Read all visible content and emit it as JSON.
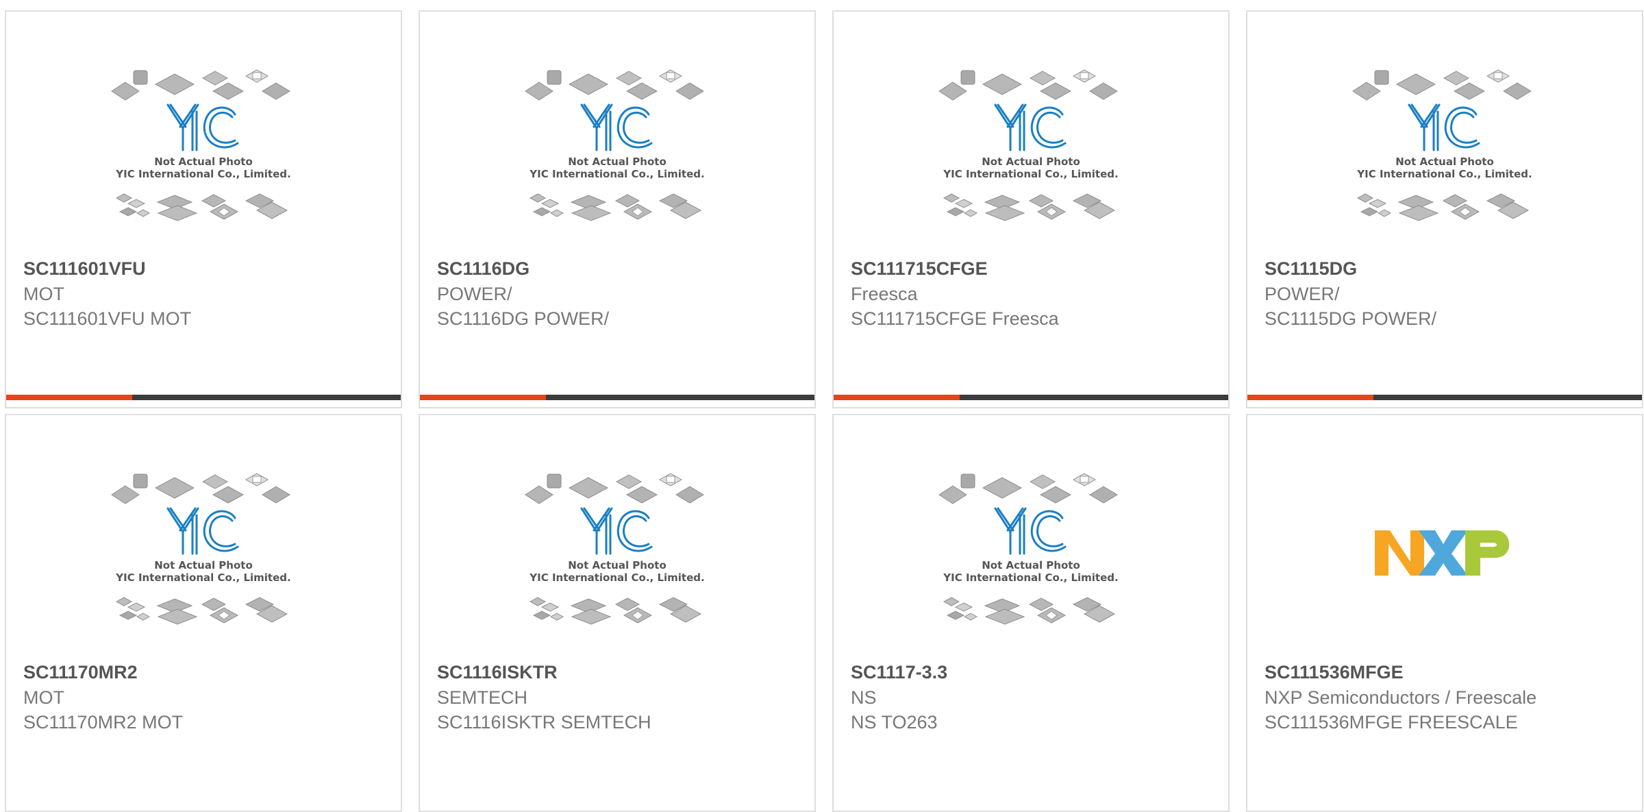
{
  "colors": {
    "accent": "#e8431a",
    "bar_dark": "#3b3b3b",
    "yic_blue": "#1a7fc4",
    "nxp_orange": "#f6a623",
    "nxp_blue": "#4fa8dc",
    "nxp_green": "#a9c93b"
  },
  "placeholder": {
    "line1": "Not Actual Photo",
    "line2": "YIC International Co., Limited."
  },
  "products": [
    {
      "part": "SC111601VFU",
      "manufacturer": "MOT",
      "description": "SC111601VFU MOT",
      "image": "yic-placeholder",
      "show_bar": true
    },
    {
      "part": "SC1116DG",
      "manufacturer": "POWER/",
      "description": "SC1116DG POWER/",
      "image": "yic-placeholder",
      "show_bar": true
    },
    {
      "part": "SC111715CFGE",
      "manufacturer": "Freesca",
      "description": "SC111715CFGE Freesca",
      "image": "yic-placeholder",
      "show_bar": true
    },
    {
      "part": "SC1115DG",
      "manufacturer": "POWER/",
      "description": "SC1115DG POWER/",
      "image": "yic-placeholder",
      "show_bar": true
    },
    {
      "part": "SC11170MR2",
      "manufacturer": "MOT",
      "description": "SC11170MR2 MOT",
      "image": "yic-placeholder",
      "show_bar": false
    },
    {
      "part": "SC1116ISKTR",
      "manufacturer": "SEMTECH",
      "description": "SC1116ISKTR SEMTECH",
      "image": "yic-placeholder",
      "show_bar": false
    },
    {
      "part": "SC1117-3.3",
      "manufacturer": "NS",
      "description": "NS TO263",
      "image": "yic-placeholder",
      "show_bar": false
    },
    {
      "part": "SC111536MFGE",
      "manufacturer": "NXP Semiconductors / Freescale",
      "description": "SC111536MFGE FREESCALE",
      "image": "nxp-logo",
      "show_bar": false
    }
  ]
}
